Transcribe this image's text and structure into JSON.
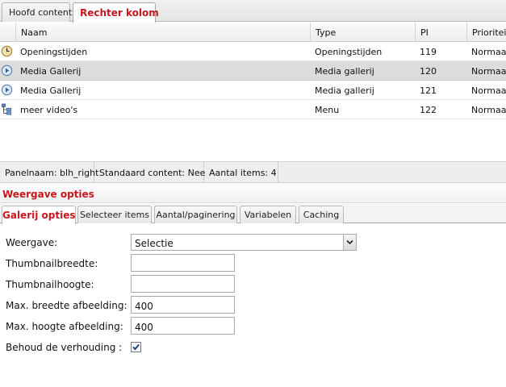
{
  "top_tabs": [
    {
      "label": "Hoofd content",
      "active": false
    },
    {
      "label": "Rechter kolom",
      "active": true
    }
  ],
  "table": {
    "columns": [
      "Naam",
      "Type",
      "PI",
      "Prioriteit"
    ],
    "rows": [
      {
        "icon": "clock-icon",
        "naam": "Openingstijden",
        "type": "Openingstijden",
        "pi": "119",
        "prioriteit": "Normaal",
        "selected": false
      },
      {
        "icon": "play-icon",
        "naam": "Media Gallerij",
        "type": "Media gallerij",
        "pi": "120",
        "prioriteit": "Normaal",
        "selected": true
      },
      {
        "icon": "play-icon",
        "naam": "Media Gallerij",
        "type": "Media gallerij",
        "pi": "121",
        "prioriteit": "Normaal",
        "selected": false
      },
      {
        "icon": "menu-tree-icon",
        "naam": "meer video's",
        "type": "Menu",
        "pi": "122",
        "prioriteit": "Normaal",
        "selected": false
      }
    ]
  },
  "status": {
    "panelnaam": "Panelnaam: blh_right",
    "standaard": "Standaard content: Nee",
    "aantal": "Aantal items: 4"
  },
  "section_title": "Weergave opties",
  "sub_tabs": [
    {
      "label": "Galerij opties",
      "active": true
    },
    {
      "label": "Selecteer items",
      "active": false
    },
    {
      "label": "Aantal/paginering",
      "active": false
    },
    {
      "label": "Variabelen",
      "active": false
    },
    {
      "label": "Caching",
      "active": false
    }
  ],
  "form": {
    "weergave": {
      "label": "Weergave:",
      "value": "Selectie"
    },
    "thumb_breedte": {
      "label": "Thumbnailbreedte:",
      "value": ""
    },
    "thumb_hoogte": {
      "label": "Thumbnailhoogte:",
      "value": ""
    },
    "max_breedte": {
      "label": "Max. breedte afbeelding:",
      "value": "400"
    },
    "max_hoogte": {
      "label": "Max. hoogte afbeelding:",
      "value": "400"
    },
    "behoud": {
      "label": "Behoud de verhouding :",
      "checked": true
    }
  },
  "colors": {
    "accent": "#c8161d",
    "selected_row": "#dcdcdc"
  }
}
